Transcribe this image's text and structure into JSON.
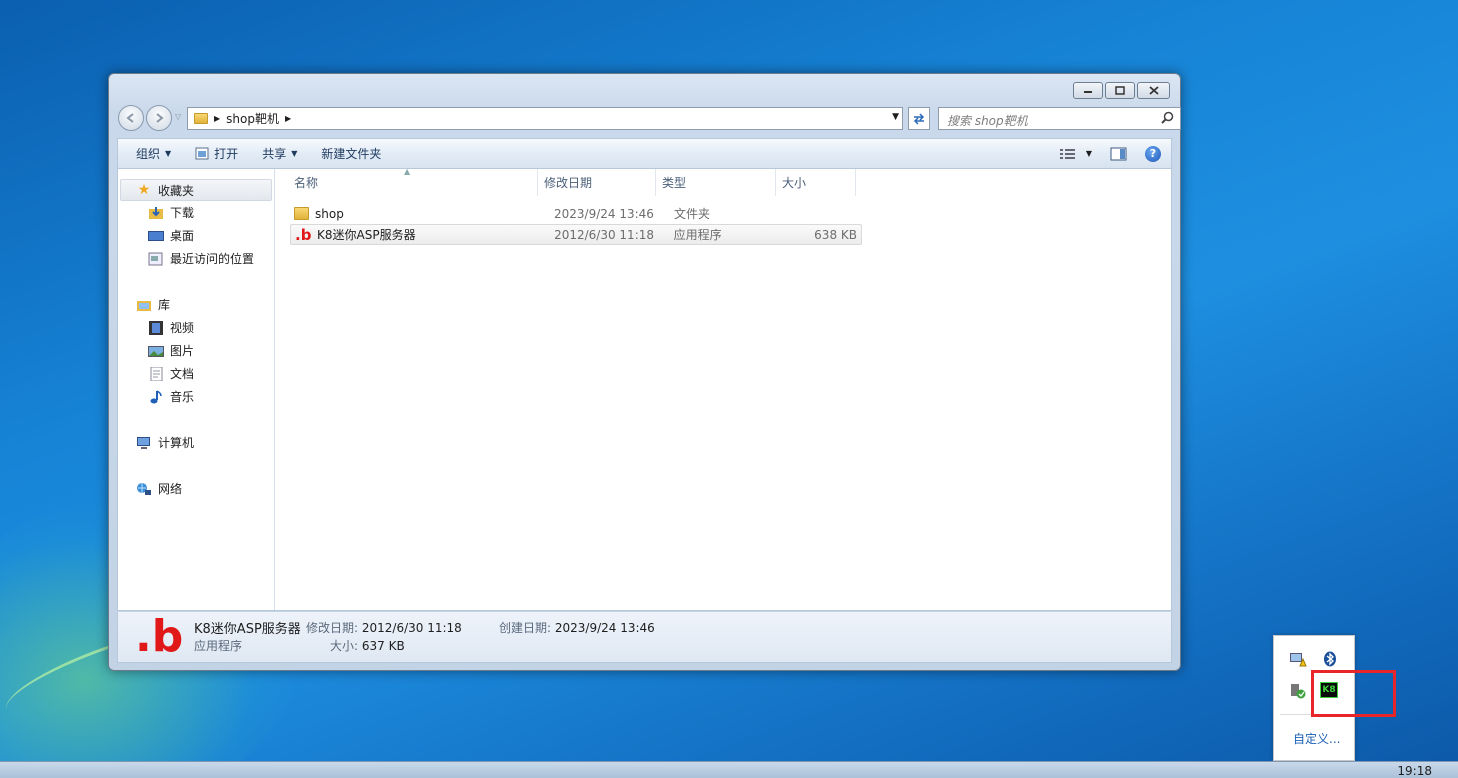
{
  "window": {
    "address_path": "shop靶机",
    "search_placeholder": "搜索 shop靶机",
    "caption": {
      "minimize": "▭",
      "maximize": "▢",
      "close": "✕"
    }
  },
  "toolbar": {
    "organize": "组织",
    "open": "打开",
    "share": "共享",
    "new_folder": "新建文件夹"
  },
  "nav": {
    "favorites": "收藏夹",
    "downloads": "下载",
    "desktop": "桌面",
    "recent": "最近访问的位置",
    "libraries": "库",
    "videos": "视频",
    "pictures": "图片",
    "documents": "文档",
    "music": "音乐",
    "computer": "计算机",
    "network": "网络"
  },
  "columns": {
    "name": "名称",
    "modified": "修改日期",
    "type": "类型",
    "size": "大小"
  },
  "files": [
    {
      "name": "shop",
      "modified": "2023/9/24 13:46",
      "type": "文件夹",
      "size": "",
      "icon": "folder-icon"
    },
    {
      "name": "K8迷你ASP服务器",
      "modified": "2012/6/30 11:18",
      "type": "应用程序",
      "size": "638 KB",
      "icon": "k8-app-icon"
    }
  ],
  "details": {
    "icon_text": ".b",
    "name": "K8迷你ASP服务器",
    "type": "应用程序",
    "modified_label": "修改日期:",
    "modified_value": "2012/6/30 11:18",
    "created_label": "创建日期:",
    "created_value": "2023/9/24 13:46",
    "size_label": "大小:",
    "size_value": "637 KB"
  },
  "file_icon_text": ".b",
  "tray": {
    "customize": "自定义...",
    "icons": [
      "network-warning-icon",
      "bluetooth-icon",
      "usb-safe-remove-icon",
      "k8-server-icon"
    ],
    "k8_label": "K8"
  },
  "taskbar": {
    "clock": "19:18"
  },
  "colors": {
    "highlight_box": "#e8262a",
    "brand_red": "#e01818"
  }
}
